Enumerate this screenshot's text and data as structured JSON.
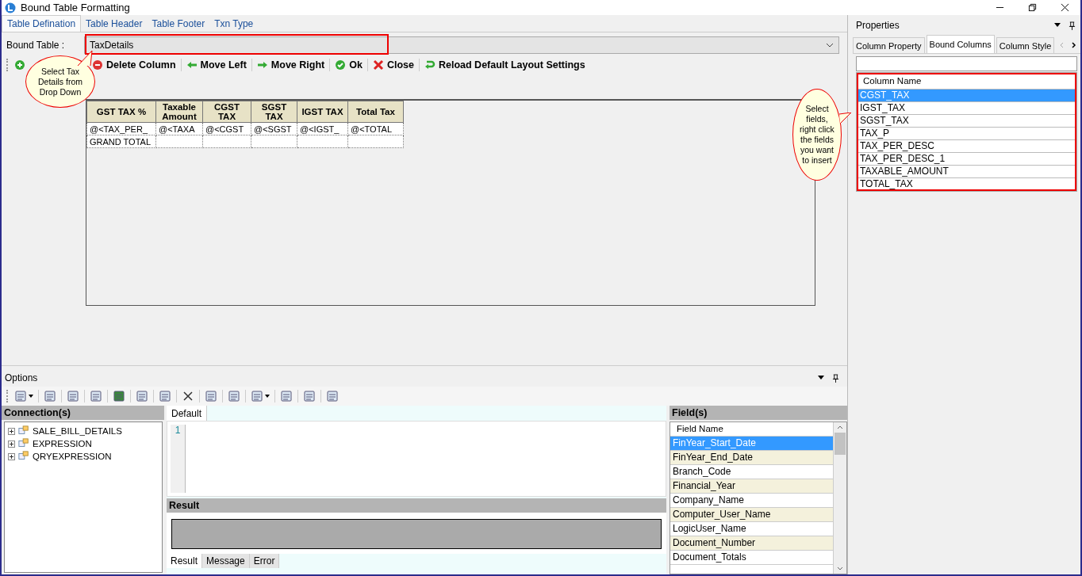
{
  "window": {
    "title": "Bound Table Formatting"
  },
  "tabs": [
    {
      "label": "Table Defination",
      "selected": true
    },
    {
      "label": "Table Header",
      "selected": false
    },
    {
      "label": "Table Footer",
      "selected": false
    },
    {
      "label": "Txn Type",
      "selected": false
    }
  ],
  "bound_table": {
    "label": "Bound Table :",
    "value": "TaxDetails"
  },
  "toolbar": [
    {
      "kind": "add"
    },
    {
      "kind": "delete",
      "label": "Delete Column"
    },
    {
      "kind": "left",
      "label": "Move Left"
    },
    {
      "kind": "right",
      "label": "Move Right"
    },
    {
      "kind": "ok",
      "label": "Ok"
    },
    {
      "kind": "close",
      "label": "Close"
    },
    {
      "kind": "reload",
      "label": "Reload Default Layout Settings"
    }
  ],
  "callouts": [
    {
      "text": "Select Tax Details from Drop Down"
    },
    {
      "text": "Select fields, right click the fields you want to insert"
    }
  ],
  "design_table": {
    "columns": [
      "GST TAX %",
      "Taxable Amount",
      "CGST TAX",
      "SGST TAX",
      "IGST TAX",
      "Total Tax"
    ],
    "rows": [
      [
        "@<TAX_PER_",
        "@<TAXA",
        "@<CGST",
        "@<SGST",
        "@<IGST_",
        "@<TOTAL"
      ],
      [
        "GRAND TOTAL",
        "",
        "",
        "",
        "",
        ""
      ]
    ]
  },
  "properties": {
    "title": "Properties",
    "tabs": [
      {
        "label": "Column Property",
        "selected": false
      },
      {
        "label": "Bound Columns",
        "selected": true
      },
      {
        "label": "Column Style",
        "selected": false
      }
    ],
    "column_header": "Column Name",
    "columns": [
      {
        "name": "CGST_TAX",
        "selected": true
      },
      {
        "name": "IGST_TAX",
        "selected": false
      },
      {
        "name": "SGST_TAX",
        "selected": false
      },
      {
        "name": "TAX_P",
        "selected": false
      },
      {
        "name": "TAX_PER_DESC",
        "selected": false
      },
      {
        "name": "TAX_PER_DESC_1",
        "selected": false
      },
      {
        "name": "TAXABLE_AMOUNT",
        "selected": false
      },
      {
        "name": "TOTAL_TAX",
        "selected": false
      }
    ]
  },
  "options": {
    "title": "Options",
    "connections": {
      "title": "Connection(s)",
      "items": [
        {
          "label": "SALE_BILL_DETAILS",
          "expanded": false
        },
        {
          "label": "EXPRESSION",
          "expanded": false
        },
        {
          "label": "QRYEXPRESSION",
          "expanded": false
        }
      ]
    },
    "editor_tabs": [
      {
        "label": "Default",
        "selected": true
      }
    ],
    "line_numbers": [
      "1"
    ],
    "result": {
      "title": "Result",
      "tabs": [
        {
          "label": "Result",
          "selected": true
        },
        {
          "label": "Message",
          "selected": false
        },
        {
          "label": "Error",
          "selected": false
        }
      ]
    },
    "fields": {
      "title": "Field(s)",
      "header": "Field Name",
      "items": [
        {
          "name": "FinYear_Start_Date",
          "selected": true
        },
        {
          "name": "FinYear_End_Date",
          "selected": false
        },
        {
          "name": "Branch_Code",
          "selected": false
        },
        {
          "name": "Financial_Year",
          "selected": false
        },
        {
          "name": "Company_Name",
          "selected": false
        },
        {
          "name": "Computer_User_Name",
          "selected": false
        },
        {
          "name": "LogicUser_Name",
          "selected": false
        },
        {
          "name": "Document_Number",
          "selected": false
        },
        {
          "name": "Document_Totals",
          "selected": false
        }
      ]
    }
  }
}
